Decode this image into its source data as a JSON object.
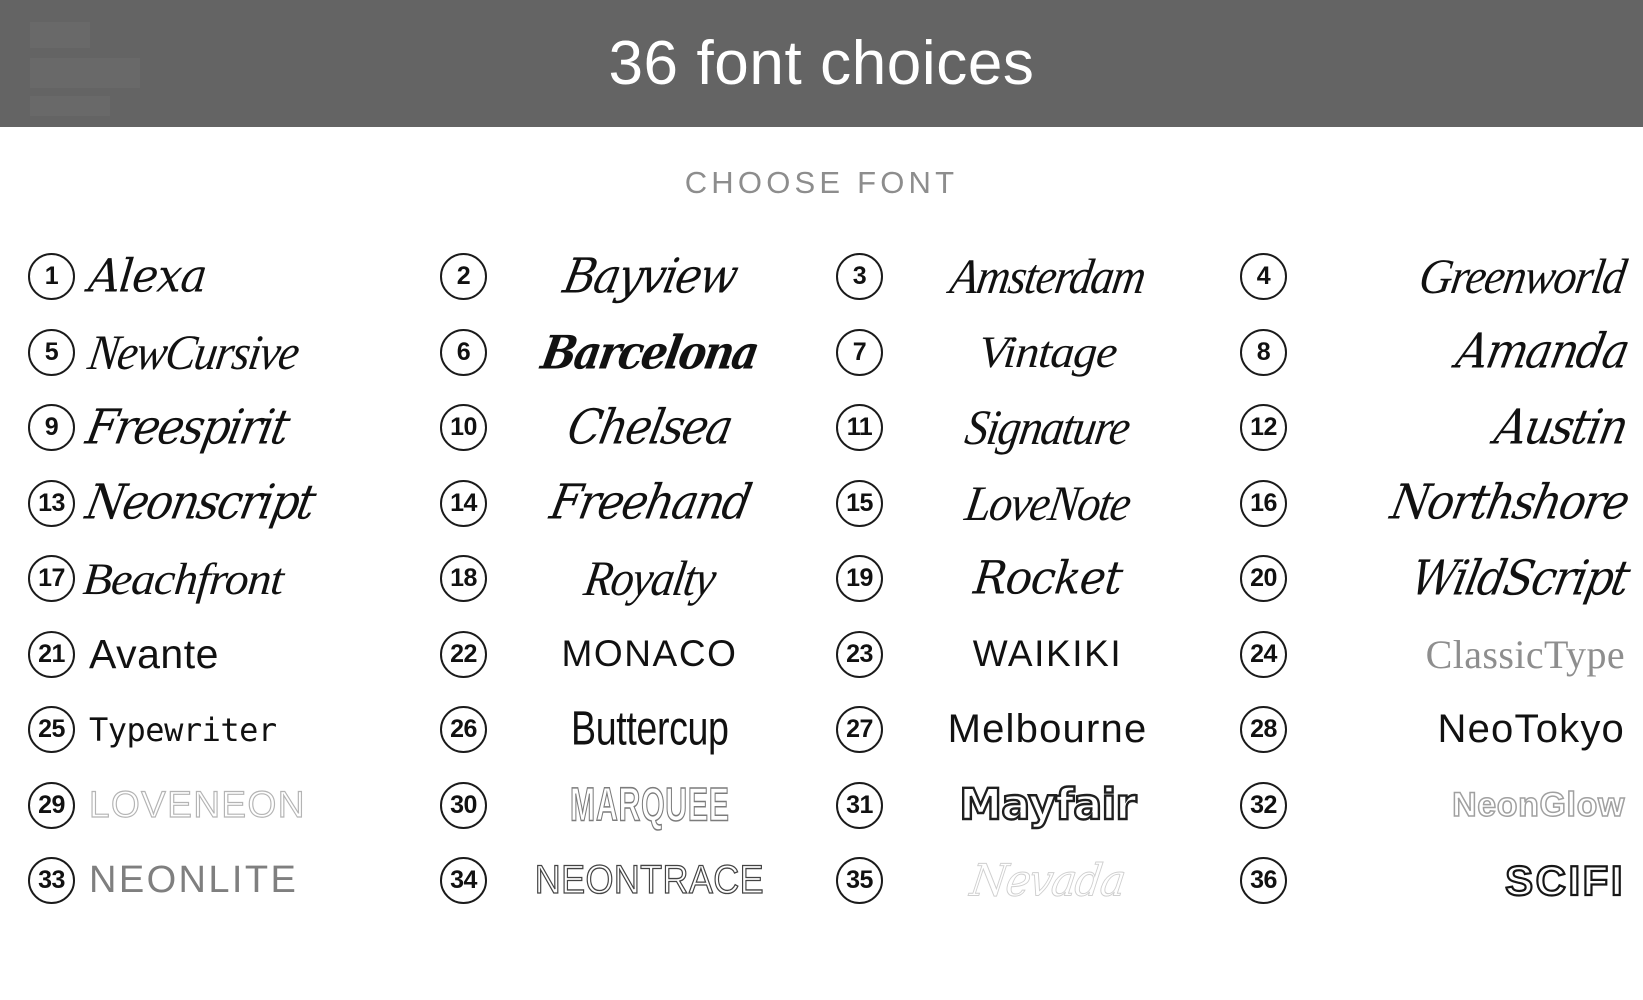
{
  "header": {
    "title": "36 font choices",
    "bar_color": "#646464",
    "title_color": "#ffffff"
  },
  "subtitle": {
    "label": "CHOOSE FONT",
    "color": "#8d8d8d"
  },
  "columns": [
    {
      "align": "left",
      "items": [
        {
          "num": "1",
          "label": "Alexa",
          "style": "f-script"
        },
        {
          "num": "5",
          "label": "NewCursive",
          "style": "f-mono-script"
        },
        {
          "num": "9",
          "label": "Freespirit",
          "style": "f-sign"
        },
        {
          "num": "13",
          "label": "Neonscript",
          "style": "f-sign"
        },
        {
          "num": "17",
          "label": "Beachfront",
          "style": "f-vintage"
        },
        {
          "num": "21",
          "label": "Avante",
          "style": "f-geo"
        },
        {
          "num": "25",
          "label": "Typewriter",
          "style": "f-typewriter"
        },
        {
          "num": "29",
          "label": "LOVENEON",
          "style": "f-neon-out"
        },
        {
          "num": "33",
          "label": "NEONLITE",
          "style": "f-neon-lite"
        }
      ]
    },
    {
      "align": "center",
      "items": [
        {
          "num": "2",
          "label": "Bayview",
          "style": "f-sign"
        },
        {
          "num": "6",
          "label": "Barcelona",
          "style": "f-brush"
        },
        {
          "num": "10",
          "label": "Chelsea",
          "style": "f-sign"
        },
        {
          "num": "14",
          "label": "Freehand",
          "style": "f-sign"
        },
        {
          "num": "18",
          "label": "Royalty",
          "style": "f-mono-script"
        },
        {
          "num": "22",
          "label": "MONACO",
          "style": "f-geo-caps"
        },
        {
          "num": "26",
          "label": "Buttercup",
          "style": "f-tall"
        },
        {
          "num": "30",
          "label": "MARQUEE",
          "style": "f-marquee"
        },
        {
          "num": "34",
          "label": "NEONTRACE",
          "style": "f-neon-trace"
        }
      ]
    },
    {
      "align": "center",
      "items": [
        {
          "num": "3",
          "label": "Amsterdam",
          "style": "f-mono-script"
        },
        {
          "num": "7",
          "label": "Vintage",
          "style": "f-vintage"
        },
        {
          "num": "11",
          "label": "Signature",
          "style": "f-mono-script"
        },
        {
          "num": "15",
          "label": "LoveNote",
          "style": "f-mono-script"
        },
        {
          "num": "19",
          "label": "Rocket",
          "style": "f-script"
        },
        {
          "num": "23",
          "label": "WAIKIKI",
          "style": "f-geo-caps"
        },
        {
          "num": "27",
          "label": "Melbourne",
          "style": "f-thin-geo"
        },
        {
          "num": "31",
          "label": "Mayfair",
          "style": "f-outline-bold"
        },
        {
          "num": "35",
          "label": "Nevada",
          "style": "f-ghost-script"
        }
      ]
    },
    {
      "align": "right",
      "items": [
        {
          "num": "4",
          "label": "Greenworld",
          "style": "f-mono-script"
        },
        {
          "num": "8",
          "label": "Amanda",
          "style": "f-sign"
        },
        {
          "num": "12",
          "label": "Austin",
          "style": "f-sign"
        },
        {
          "num": "16",
          "label": "Northshore",
          "style": "f-sign"
        },
        {
          "num": "20",
          "label": "WildScript",
          "style": "f-sign"
        },
        {
          "num": "24",
          "label": "ClassicType",
          "style": "f-serif"
        },
        {
          "num": "28",
          "label": "NeoTokyo",
          "style": "f-thin-geo"
        },
        {
          "num": "32",
          "label": "NeonGlow",
          "style": "f-neon-mid"
        },
        {
          "num": "36",
          "label": "SCIFI",
          "style": "f-scifi"
        }
      ]
    }
  ]
}
